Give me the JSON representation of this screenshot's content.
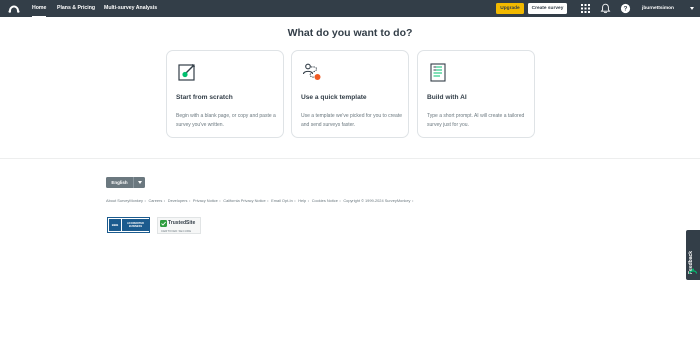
{
  "nav": {
    "home": "Home",
    "plans": "Plans & Pricing",
    "multi_survey": "Multi-survey Analysis",
    "upgrade": "Upgrade",
    "create_survey": "Create survey",
    "username": "jburnettsimon"
  },
  "main": {
    "heading": "What do you want to do?",
    "cards": [
      {
        "title": "Start from scratch",
        "description": "Begin with a blank page, or copy and paste a survey you've written.",
        "icon": "pencil-icon"
      },
      {
        "title": "Use a quick template",
        "description": "Use a template we've picked for you to create and send surveys faster.",
        "icon": "template-icon"
      },
      {
        "title": "Build with AI",
        "description": "Type a short prompt. AI will create a tailored survey just for you.",
        "icon": "ai-document-icon"
      }
    ]
  },
  "footer": {
    "language": "English",
    "links": [
      "About SurveyMonkey",
      "Careers",
      "Developers",
      "Privacy Notice",
      "California Privacy Notice",
      "Email Opt-In",
      "Help",
      "Cookies Notice",
      "Copyright © 1999-2024 SurveyMonkey"
    ],
    "separator": "•",
    "bbb_mark": "BBB",
    "bbb_text": "ACCREDITED BUSINESS",
    "trusted_name": "TrustedSite",
    "trusted_sub": "CERTIFIED SECURE"
  },
  "feedback": "Feedback",
  "colors": {
    "topbar": "#333e48",
    "upgrade": "#f2b900",
    "accent_green": "#00bf6f",
    "accent_red": "#f05b24"
  }
}
